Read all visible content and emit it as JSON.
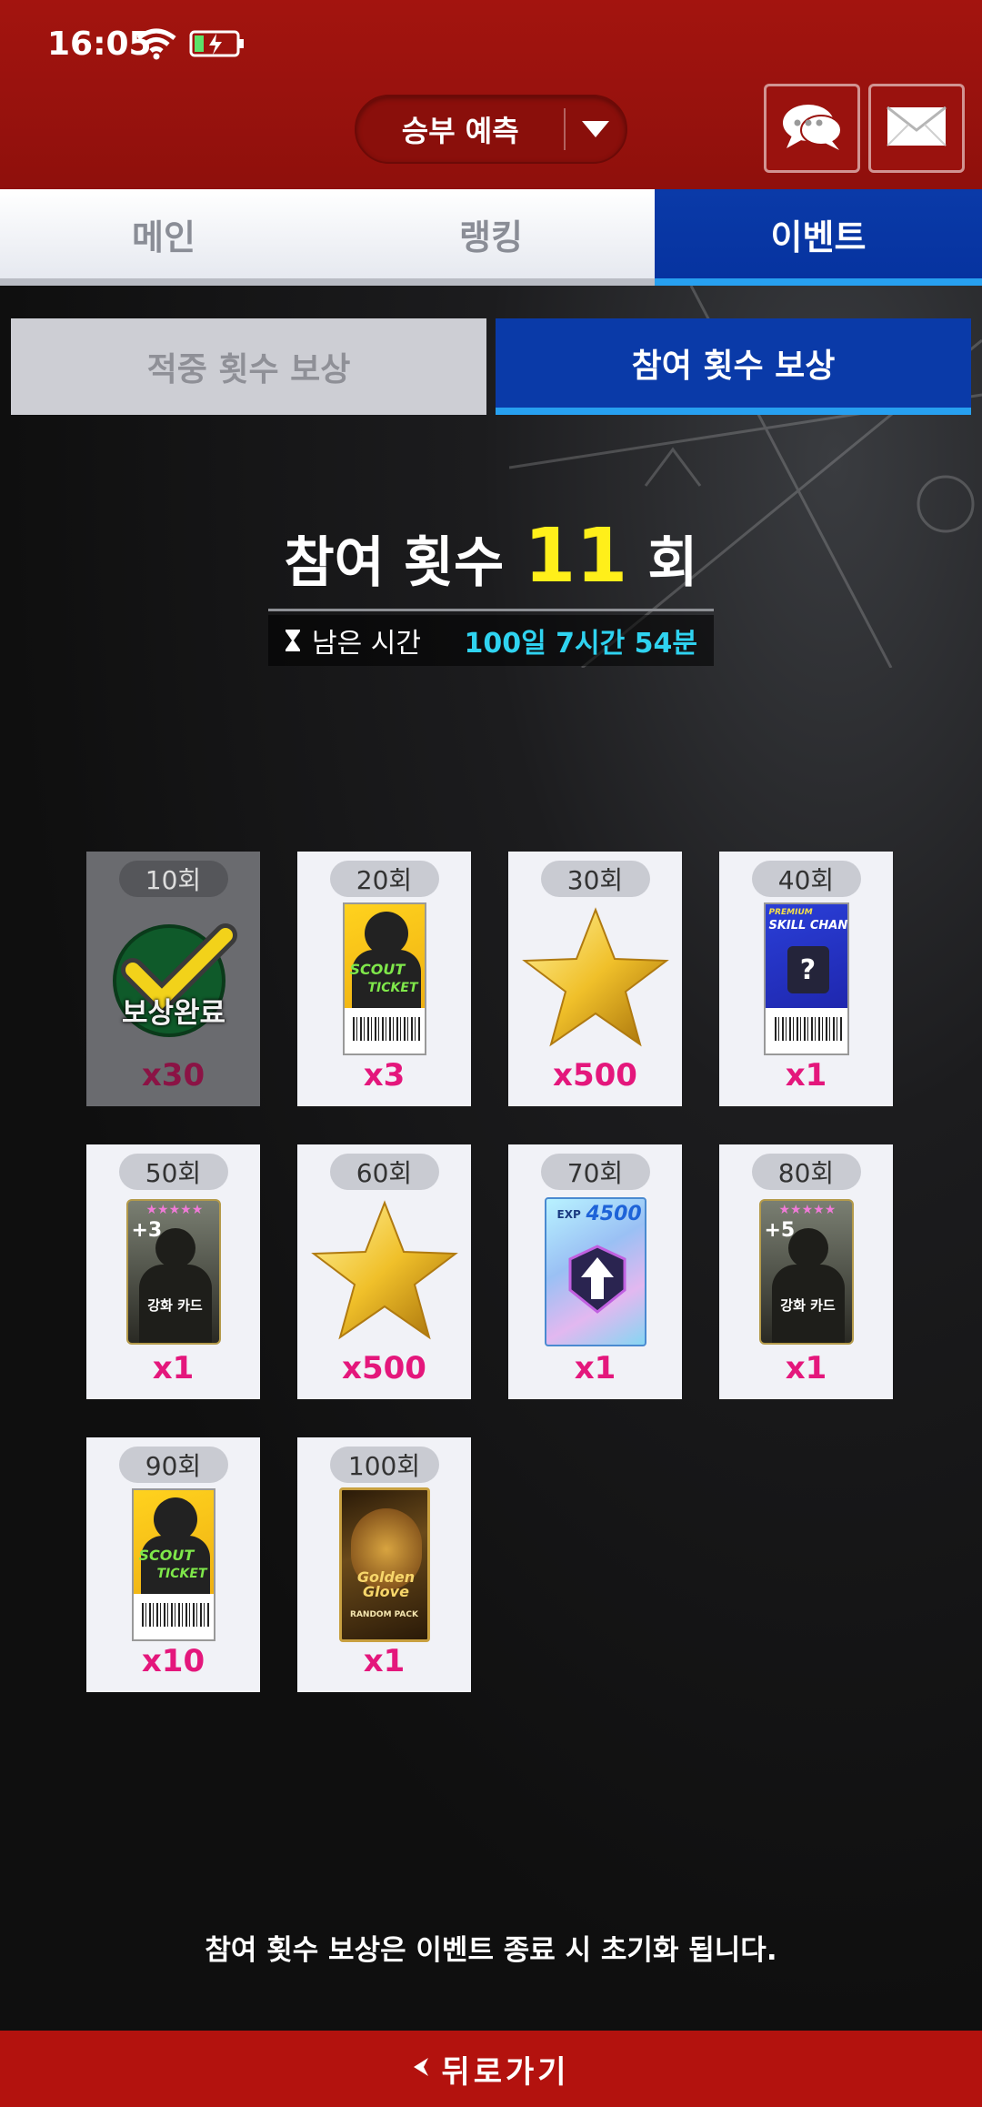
{
  "status": {
    "time": "16:05"
  },
  "header": {
    "predict_label": "승부 예측",
    "chat_icon": "chat-bubble-icon",
    "mail_icon": "envelope-icon"
  },
  "tabs": [
    {
      "label": "메인"
    },
    {
      "label": "랭킹"
    },
    {
      "label": "이벤트"
    }
  ],
  "subtabs": [
    {
      "label": "적중 횟수 보상"
    },
    {
      "label": "참여 횟수 보상"
    }
  ],
  "participation": {
    "label": "참여 횟수",
    "count": "11",
    "unit": "회",
    "time_label": "남은 시간",
    "time_value": "100일 7시간 54분"
  },
  "rewards": [
    {
      "milestone": "10회",
      "qty": "x30",
      "item": "claimed-ticket",
      "claimed_text": "보상완료"
    },
    {
      "milestone": "20회",
      "qty": "x3",
      "item": "scout-ticket"
    },
    {
      "milestone": "30회",
      "qty": "x500",
      "item": "gold-star"
    },
    {
      "milestone": "40회",
      "qty": "x1",
      "item": "skill-change-ticket"
    },
    {
      "milestone": "50회",
      "qty": "x1",
      "item": "enhance-card-plus3"
    },
    {
      "milestone": "60회",
      "qty": "x500",
      "item": "gold-star"
    },
    {
      "milestone": "70회",
      "qty": "x1",
      "item": "exp-card"
    },
    {
      "milestone": "80회",
      "qty": "x1",
      "item": "enhance-card-plus5"
    },
    {
      "milestone": "90회",
      "qty": "x10",
      "item": "scout-ticket"
    },
    {
      "milestone": "100회",
      "qty": "x1",
      "item": "golden-glove-pack"
    }
  ],
  "art_text": {
    "scout_top": "SCOUT",
    "scout_bottom": "TICKET",
    "skill_premium": "PREMIUM",
    "skill_change": "SKILL CHANGE",
    "enhance_card": "강화 카드",
    "plus3": "+3",
    "plus5": "+5",
    "exp_label": "EXP",
    "exp_value": "4500",
    "golden_glove": "Golden Glove",
    "random_pack": "RANDOM PACK"
  },
  "notice": "참여 횟수 보상은 이벤트 종료 시 초기화 됩니다.",
  "footer": {
    "back_label": "뒤로가기"
  },
  "colors": {
    "header_red": "#a3140f",
    "active_blue": "#0a3aa8",
    "accent_cyan": "#2fd3f0",
    "count_yellow": "#ffef1a",
    "qty_pink": "#e4177c"
  }
}
